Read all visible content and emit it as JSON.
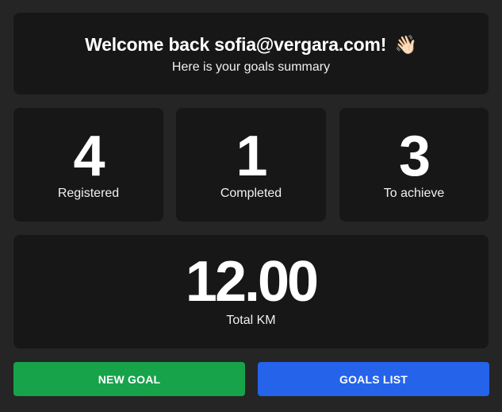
{
  "welcome": {
    "title": "Welcome back sofia@vergara.com!",
    "emoji": "👋🏻",
    "subtitle": "Here is your goals summary"
  },
  "stats": [
    {
      "value": "4",
      "label": "Registered"
    },
    {
      "value": "1",
      "label": "Completed"
    },
    {
      "value": "3",
      "label": "To achieve"
    }
  ],
  "total_km": {
    "value": "12.00",
    "label": "Total KM"
  },
  "buttons": {
    "new_goal": "NEW GOAL",
    "goals_list": "GOALS LIST"
  },
  "colors": {
    "background": "#252525",
    "card": "#171717",
    "new_goal": "#16a34a",
    "goals_list": "#2563eb"
  },
  "icons": {
    "wave": "waving-hand-icon"
  }
}
